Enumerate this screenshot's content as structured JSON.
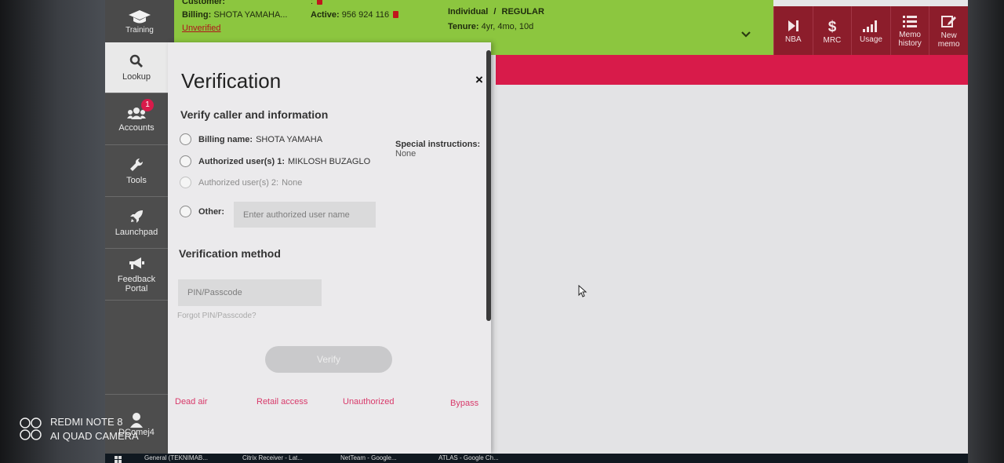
{
  "header": {
    "training_label": "Training",
    "customer_label": "Customer:",
    "billing_label": "Billing:",
    "billing_value": "SHOTA YAMAHA...",
    "unverified_label": "Unverified",
    "colon": ":",
    "active_label": "Active:",
    "active_value": "956 924 116",
    "account_type": "Individual",
    "account_sep": "/",
    "account_plan": "REGULAR",
    "tenure_label": "Tenure:",
    "tenure_value": "4yr, 4mo, 10d"
  },
  "actions": [
    {
      "label": "NBA",
      "icon": "skip-icon"
    },
    {
      "label": "MRC",
      "icon": "dollar-icon"
    },
    {
      "label": "Usage",
      "icon": "signal-bars-icon"
    },
    {
      "label": "Memo history",
      "icon": "list-icon"
    },
    {
      "label": "New memo",
      "icon": "edit-icon"
    }
  ],
  "nav": {
    "lookup": "Lookup",
    "accounts": "Accounts",
    "accounts_badge": "1",
    "tools": "Tools",
    "launchpad": "Launchpad",
    "feedback": "Feedback Portal",
    "user": "DComej4"
  },
  "verification": {
    "title": "Verification",
    "close": "×",
    "section1": "Verify caller and information",
    "billing_name_label": "Billing name:",
    "billing_name_value": "SHOTA YAMAHA",
    "auth1_label": "Authorized user(s) 1:",
    "auth1_value": "MIKLOSH BUZAGLO",
    "auth2_label": "Authorized user(s) 2:",
    "auth2_value": "None",
    "other_label": "Other:",
    "other_placeholder": "Enter authorized user name",
    "special_label": "Special instructions:",
    "special_value": "None",
    "section2": "Verification method",
    "pin_placeholder": "PIN/Passcode",
    "forgot": "Forgot PIN/Passcode?",
    "verify_button": "Verify",
    "footer_links": [
      "Dead air",
      "Retail access",
      "Unauthorized",
      "Bypass"
    ]
  },
  "watermark": {
    "line1": "REDMI NOTE 8",
    "line2": "AI QUAD CAMERA"
  },
  "taskbar": [
    "General (TEKNIMAB...",
    "Citrix Receiver - Lat...",
    "NetTeam - Google...",
    "ATLAS - Google Ch..."
  ],
  "colors": {
    "header_green": "#8cc63f",
    "action_maroon": "#8c1d2b",
    "accent_pink": "#d81b4a",
    "nav_gray": "#4d4d4d"
  }
}
